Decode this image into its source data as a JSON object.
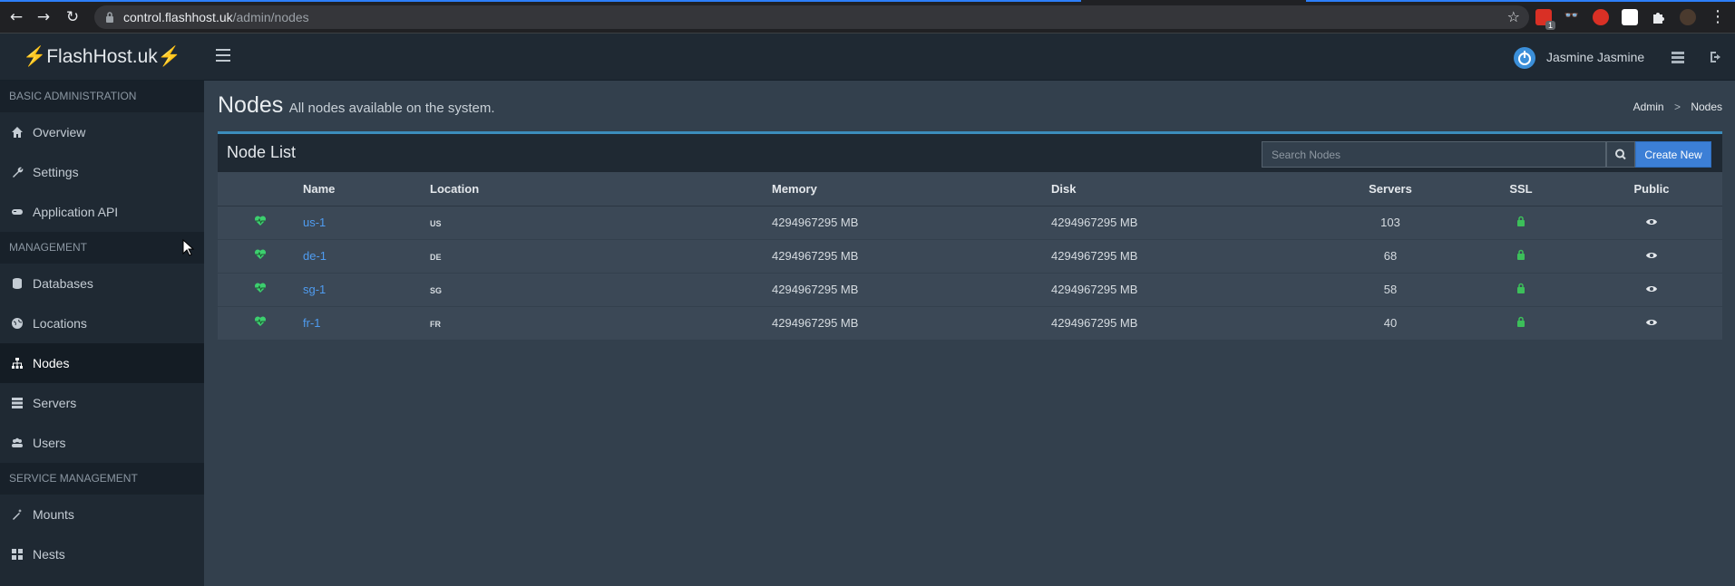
{
  "browser": {
    "url_host": "control.flashhost.uk",
    "url_path": "/admin/nodes",
    "ext_badge": "1"
  },
  "app": {
    "logo_text": "FlashHost.uk",
    "logo_bolt": "⚡",
    "user_name": "Jasmine Jasmine"
  },
  "sidebar": {
    "sections": [
      {
        "header": "BASIC ADMINISTRATION",
        "items": [
          {
            "label": "Overview",
            "icon": "home-icon"
          },
          {
            "label": "Settings",
            "icon": "wrench-icon"
          },
          {
            "label": "Application API",
            "icon": "gamepad-icon"
          }
        ]
      },
      {
        "header": "MANAGEMENT",
        "items": [
          {
            "label": "Databases",
            "icon": "database-icon"
          },
          {
            "label": "Locations",
            "icon": "globe-icon"
          },
          {
            "label": "Nodes",
            "icon": "sitemap-icon"
          },
          {
            "label": "Servers",
            "icon": "server-icon"
          },
          {
            "label": "Users",
            "icon": "users-icon"
          }
        ]
      },
      {
        "header": "SERVICE MANAGEMENT",
        "items": [
          {
            "label": "Mounts",
            "icon": "magic-icon"
          },
          {
            "label": "Nests",
            "icon": "th-large-icon"
          }
        ]
      }
    ],
    "active": "Nodes"
  },
  "page": {
    "title": "Nodes",
    "subtitle": "All nodes available on the system.",
    "breadcrumb": [
      "Admin",
      "Nodes"
    ],
    "breadcrumb_sep": ">"
  },
  "node_list": {
    "title": "Node List",
    "search_placeholder": "Search Nodes",
    "create_label": "Create New",
    "columns": [
      "",
      "Name",
      "Location",
      "Memory",
      "Disk",
      "Servers",
      "SSL",
      "Public"
    ],
    "rows": [
      {
        "name": "us-1",
        "location": "US",
        "memory": "4294967295 MB",
        "disk": "4294967295 MB",
        "servers": "103"
      },
      {
        "name": "de-1",
        "location": "DE",
        "memory": "4294967295 MB",
        "disk": "4294967295 MB",
        "servers": "68"
      },
      {
        "name": "sg-1",
        "location": "SG",
        "memory": "4294967295 MB",
        "disk": "4294967295 MB",
        "servers": "58"
      },
      {
        "name": "fr-1",
        "location": "FR",
        "memory": "4294967295 MB",
        "disk": "4294967295 MB",
        "servers": "40"
      }
    ]
  },
  "colors": {
    "heartbeat": "#3ccf6e",
    "ssl_lock": "#3cbf5a",
    "link": "#4f9cf0",
    "primary_button": "#3c7fd6",
    "box_border": "#3c8dbc"
  }
}
